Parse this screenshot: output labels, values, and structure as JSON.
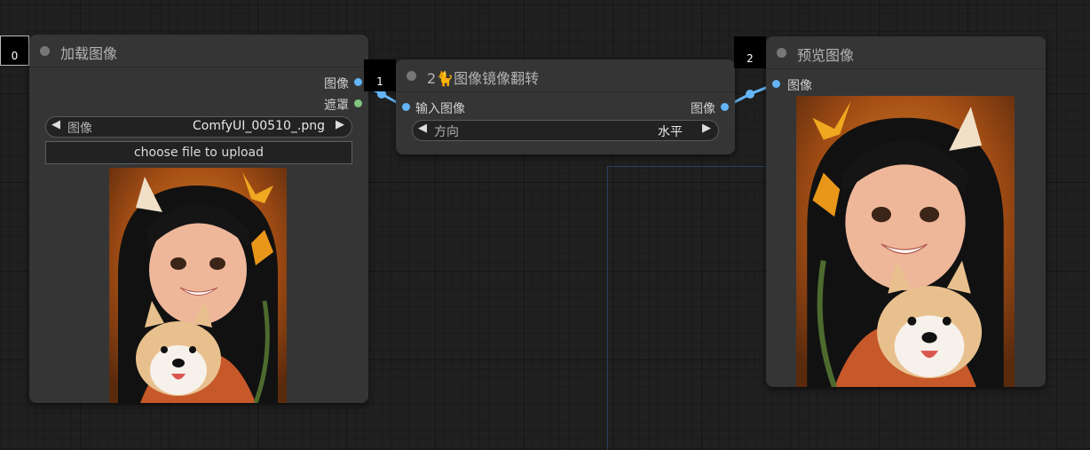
{
  "nodes": {
    "load_image": {
      "id": "0",
      "title": "加载图像",
      "outputs": [
        "图像",
        "遮罩"
      ],
      "image_widget": {
        "label": "图像",
        "value": "ComfyUI_00510_.png"
      },
      "upload_label": "choose file to upload"
    },
    "flip_image": {
      "id": "1",
      "title": "2🐈图像镜像翻转",
      "input": "输入图像",
      "output": "图像",
      "direction_widget": {
        "label": "方向",
        "value": "水平"
      }
    },
    "preview_image": {
      "id": "2",
      "title": "预览图像",
      "input": "图像"
    }
  },
  "colors": {
    "canvas": "#202020",
    "node_body": "#353535",
    "link": "#64b5f6",
    "image_slot": "#64b5f6",
    "mask_slot": "#7fc47f"
  },
  "icons": {
    "left_arrow": "◀",
    "right_arrow": "▶"
  }
}
